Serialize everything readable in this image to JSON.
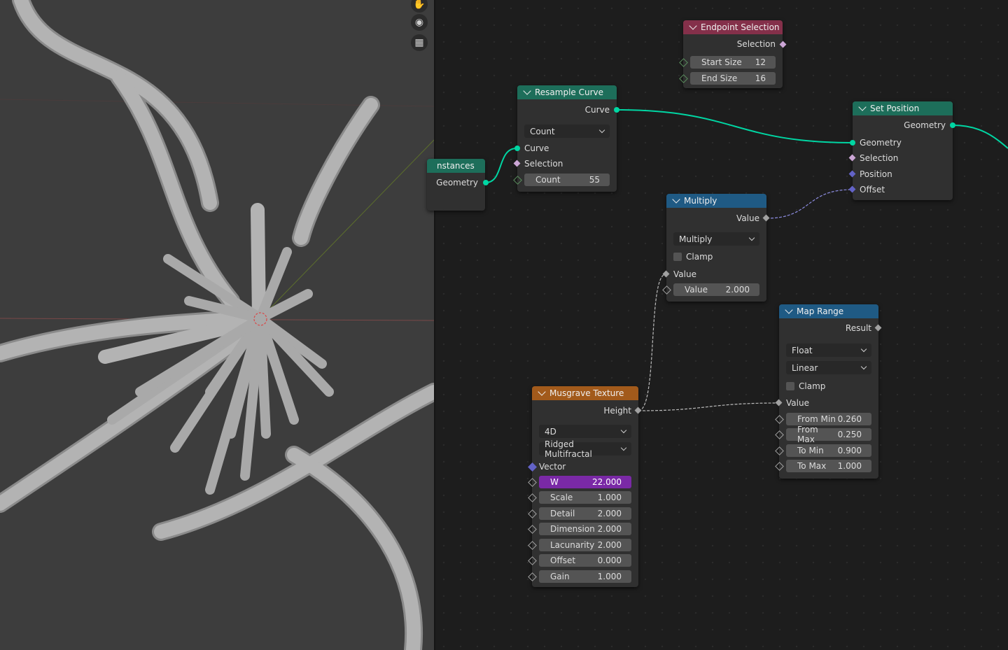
{
  "colors": {
    "geometry_socket": "#00d6a3",
    "float_socket": "#a1a1a1",
    "vector_socket": "#6363c7",
    "boolean_socket": "#cca6d6",
    "integer_socket": "#598c5c",
    "wire_geometry": "#00d6a3",
    "header_red": "#84304a",
    "header_teal": "#1d6e5a",
    "header_blue": "#1f5a84",
    "header_orange": "#a25a1b",
    "accent_field": "#7a29a6"
  },
  "viewport_tools": [
    "hand-icon",
    "camera-icon",
    "grid-icon"
  ],
  "nodes": {
    "instances": {
      "title": "nstances",
      "out_geometry": "Geometry"
    },
    "endpoint": {
      "title": "Endpoint Selection",
      "out_selection": "Selection",
      "start_label": "Start Size",
      "start_value": "12",
      "end_label": "End Size",
      "end_value": "16"
    },
    "resample": {
      "title": "Resample Curve",
      "out_curve": "Curve",
      "mode": "Count",
      "in_curve": "Curve",
      "in_selection": "Selection",
      "count_label": "Count",
      "count_value": "55"
    },
    "setpos": {
      "title": "Set Position",
      "out_geometry": "Geometry",
      "in_geometry": "Geometry",
      "in_selection": "Selection",
      "in_position": "Position",
      "in_offset": "Offset"
    },
    "multiply": {
      "title": "Multiply",
      "out_value": "Value",
      "operation": "Multiply",
      "clamp": "Clamp",
      "in_value": "Value",
      "value_label": "Value",
      "value_value": "2.000"
    },
    "maprange": {
      "title": "Map Range",
      "out_result": "Result",
      "data_type": "Float",
      "interpolation": "Linear",
      "clamp": "Clamp",
      "in_value": "Value",
      "fields": [
        {
          "label": "From Min",
          "value": "0.260"
        },
        {
          "label": "From Max",
          "value": "0.250"
        },
        {
          "label": "To Min",
          "value": "0.900"
        },
        {
          "label": "To Max",
          "value": "1.000"
        }
      ]
    },
    "musgrave": {
      "title": "Musgrave Texture",
      "out_height": "Height",
      "dimensions": "4D",
      "type": "Ridged Multifractal",
      "in_vector": "Vector",
      "fields": [
        {
          "label": "W",
          "value": "22.000"
        },
        {
          "label": "Scale",
          "value": "1.000"
        },
        {
          "label": "Detail",
          "value": "2.000"
        },
        {
          "label": "Dimension",
          "value": "2.000"
        },
        {
          "label": "Lacunarity",
          "value": "2.000"
        },
        {
          "label": "Offset",
          "value": "0.000"
        },
        {
          "label": "Gain",
          "value": "1.000"
        }
      ]
    }
  }
}
